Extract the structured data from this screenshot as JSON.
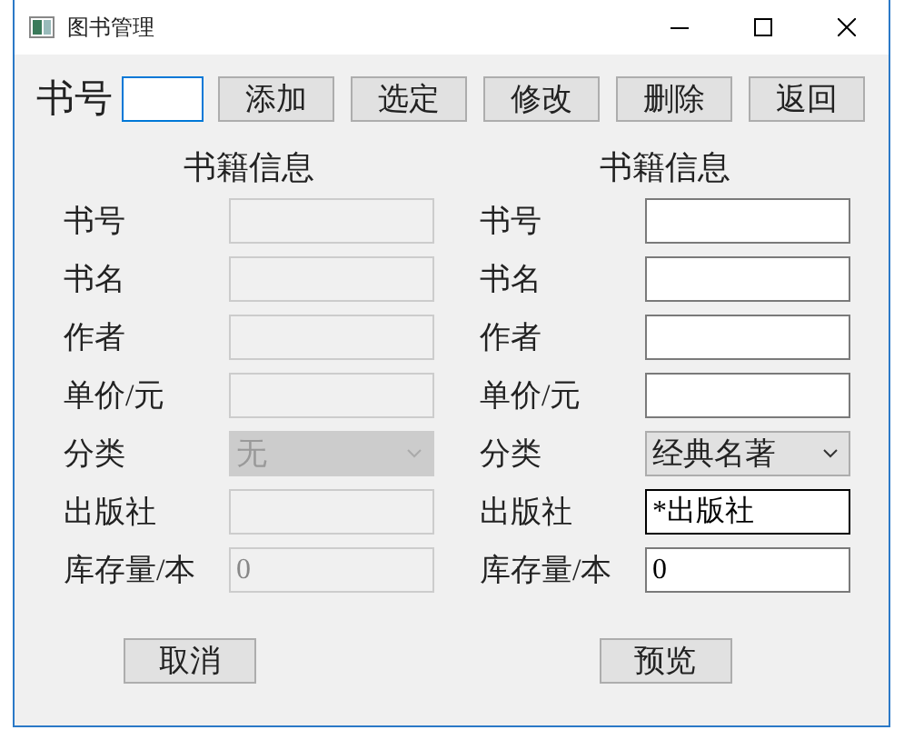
{
  "window": {
    "title": "图书管理"
  },
  "search": {
    "label": "书号",
    "focused": true
  },
  "toolbar": [
    "添加",
    "选定",
    "修改",
    "删除",
    "返回"
  ],
  "panels": [
    {
      "heading": "书籍信息",
      "button": "取消",
      "fields": [
        {
          "label": "书号",
          "kind": "text",
          "disabled": true,
          "focused": false
        },
        {
          "label": "书名",
          "kind": "text",
          "disabled": true,
          "focused": false
        },
        {
          "label": "作者",
          "kind": "text",
          "disabled": true,
          "focused": false
        },
        {
          "label": "单价/元",
          "kind": "text",
          "disabled": true,
          "focused": false
        },
        {
          "label": "分类",
          "kind": "select",
          "value": "无",
          "disabled": true,
          "focused": false
        },
        {
          "label": "出版社",
          "kind": "text",
          "disabled": true,
          "focused": false
        },
        {
          "label": "库存量/本",
          "kind": "text",
          "value": "0",
          "disabled": true,
          "focused": false
        }
      ]
    },
    {
      "heading": "书籍信息",
      "button": "预览",
      "fields": [
        {
          "label": "书号",
          "kind": "text",
          "disabled": false,
          "focused": false
        },
        {
          "label": "书名",
          "kind": "text",
          "disabled": false,
          "focused": false
        },
        {
          "label": "作者",
          "kind": "text",
          "disabled": false,
          "focused": false
        },
        {
          "label": "单价/元",
          "kind": "text",
          "disabled": false,
          "focused": false
        },
        {
          "label": "分类",
          "kind": "select",
          "value": "经典名著",
          "disabled": false,
          "focused": false
        },
        {
          "label": "出版社",
          "kind": "text",
          "value": "*出版社",
          "disabled": false,
          "focused": true
        },
        {
          "label": "库存量/本",
          "kind": "text",
          "value": "0",
          "disabled": false,
          "focused": false
        }
      ]
    }
  ]
}
